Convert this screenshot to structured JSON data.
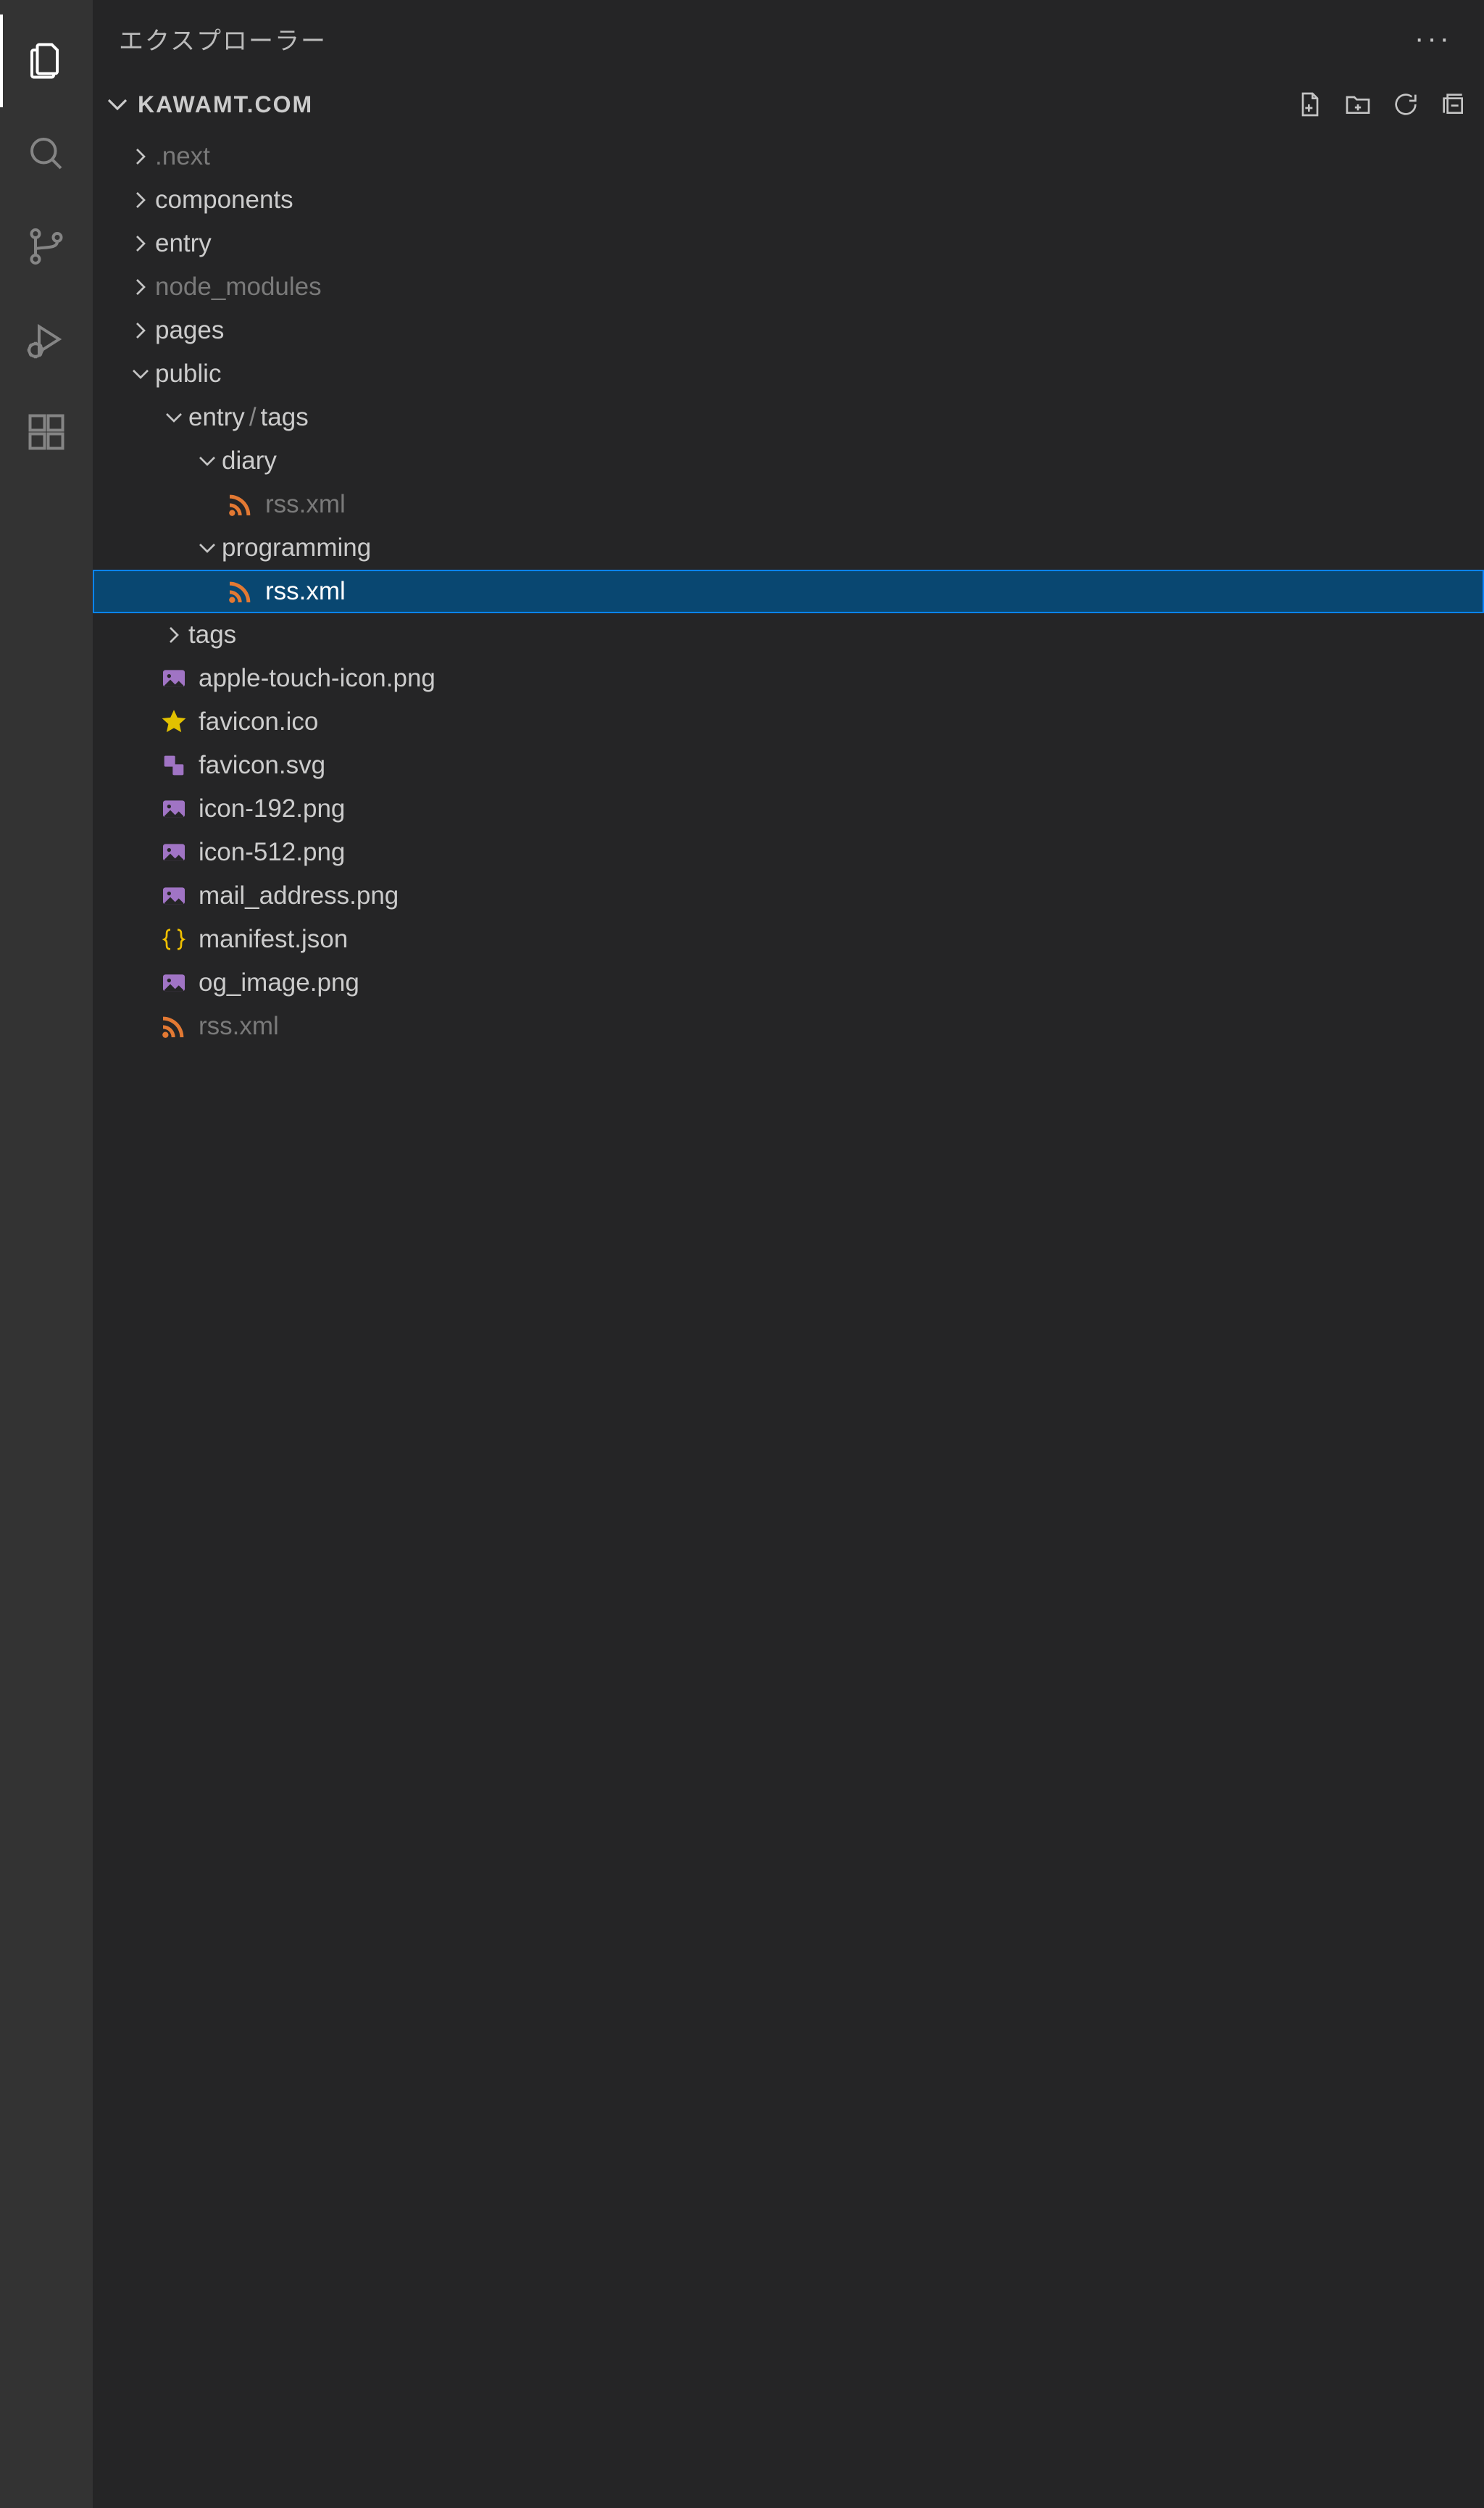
{
  "explorer": {
    "title": "エクスプローラー",
    "section": "KAWAMT.COM"
  },
  "tree": {
    "next": ".next",
    "components": "components",
    "entry": "entry",
    "node_modules": "node_modules",
    "pages": "pages",
    "public": "public",
    "entry_path_a": "entry",
    "entry_path_b": "tags",
    "diary": "diary",
    "rss1": "rss.xml",
    "programming": "programming",
    "rss2": "rss.xml",
    "tags": "tags",
    "apple": "apple-touch-icon.png",
    "favico": "favicon.ico",
    "favsvg": "favicon.svg",
    "icon192": "icon-192.png",
    "icon512": "icon-512.png",
    "mail": "mail_address.png",
    "manifest": "manifest.json",
    "og": "og_image.png",
    "rss3": "rss.xml"
  }
}
